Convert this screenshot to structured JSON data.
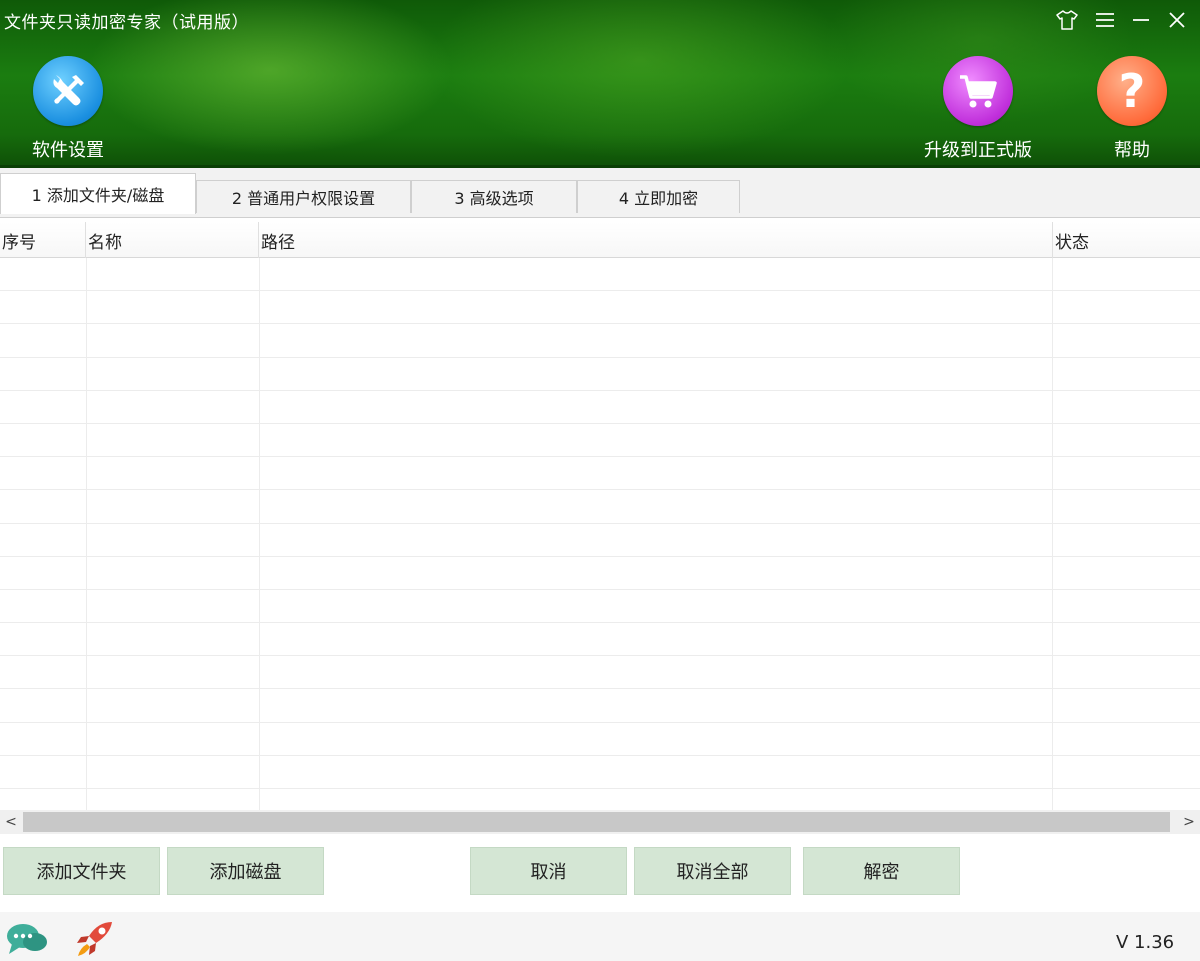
{
  "window": {
    "title": "文件夹只读加密专家（试用版）",
    "controls": [
      "skin-icon",
      "menu-icon",
      "minimize-icon",
      "close-icon"
    ]
  },
  "toolbar": {
    "settings_label": "软件设置",
    "upgrade_label": "升级到正式版",
    "help_label": "帮助",
    "help_glyph": "?"
  },
  "tabs": [
    {
      "label": "1 添加文件夹/磁盘",
      "active": true
    },
    {
      "label": "2 普通用户权限设置",
      "active": false
    },
    {
      "label": "3 高级选项",
      "active": false
    },
    {
      "label": "4 立即加密",
      "active": false
    }
  ],
  "table": {
    "columns": [
      "序号",
      "名称",
      "路径",
      "状态"
    ],
    "rows": []
  },
  "scrollbar": {
    "left_arrow": "<",
    "right_arrow": ">"
  },
  "buttons": {
    "add_folder": "添加文件夹",
    "add_disk": "添加磁盘",
    "cancel": "取消",
    "cancel_all": "取消全部",
    "decrypt": "解密"
  },
  "footer": {
    "version": "V 1.36"
  },
  "colors": {
    "header_green": "#1b7d10",
    "button_bg": "#d4e6d4",
    "settings_icon_blue": "#1a8fe0",
    "upgrade_icon_purple": "#c02fdb",
    "help_icon_orange": "#ff6a3a"
  }
}
